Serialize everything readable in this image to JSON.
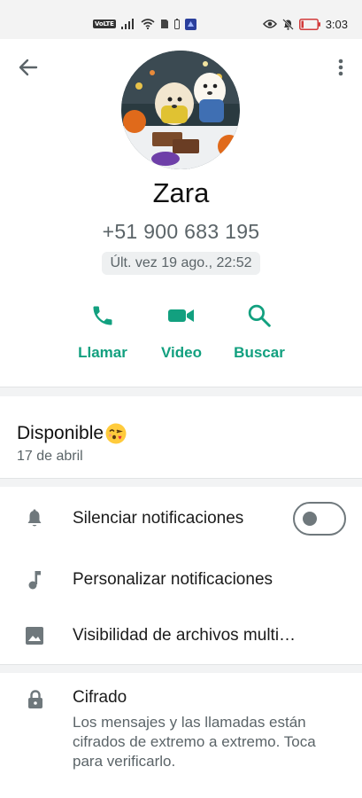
{
  "status_bar": {
    "volte": "VoLTE",
    "time": "3:03"
  },
  "header": {
    "back_icon": "arrow-left-icon",
    "more_icon": "more-vertical-icon"
  },
  "contact": {
    "name": "Zara",
    "phone": "+51 900 683 195",
    "last_seen": "Últ. vez 19 ago., 22:52"
  },
  "actions": [
    {
      "label": "Llamar",
      "icon": "phone-icon"
    },
    {
      "label": "Video",
      "icon": "video-camera-icon"
    },
    {
      "label": "Buscar",
      "icon": "search-icon"
    }
  ],
  "about": {
    "status": "Disponible",
    "emoji": "face-blowing-kiss-emoji",
    "date": "17 de abril"
  },
  "settings": [
    {
      "label": "Silenciar notificaciones",
      "icon": "bell-icon",
      "toggle_on": false
    },
    {
      "label": "Personalizar notificaciones",
      "icon": "music-note-icon"
    },
    {
      "label": "Visibilidad de archivos multi…",
      "icon": "image-icon"
    }
  ],
  "encryption": {
    "title": "Cifrado",
    "description": "Los mensajes y las llamadas están cifrados de extremo a extremo. Toca para verificarlo.",
    "icon": "lock-icon"
  },
  "colors": {
    "accent": "#12a07f",
    "secondary_text": "#5b6468",
    "icon_gray": "#6f787c"
  }
}
